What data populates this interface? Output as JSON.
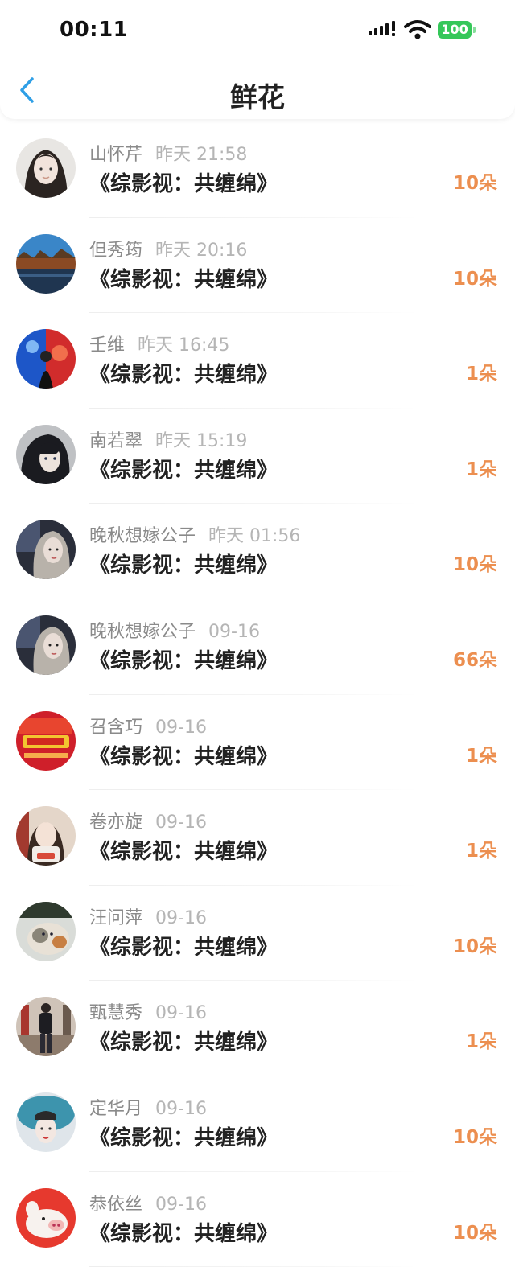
{
  "status_bar": {
    "time": "00:11",
    "battery": "100",
    "battery_color": "#35c759"
  },
  "nav": {
    "title": "鲜花",
    "back_icon": "chevron-left-icon",
    "accent": "#2f9fe6"
  },
  "colors": {
    "amount": "#ec8f50",
    "name": "#8a8a8a",
    "date": "#b5b5b5"
  },
  "records": [
    {
      "name": "山怀芹",
      "time": "昨天 21:58",
      "book": "《综影视：共缠绵》",
      "amount": "10朵",
      "avatar": "girl-portrait"
    },
    {
      "name": "但秀筠",
      "time": "昨天 20:16",
      "book": "《综影视：共缠绵》",
      "amount": "10朵",
      "avatar": "lake-landscape"
    },
    {
      "name": "壬维",
      "time": "昨天 16:45",
      "book": "《综影视：共缠绵》",
      "amount": "1朵",
      "avatar": "red-blue-art"
    },
    {
      "name": "南若翠",
      "time": "昨天 15:19",
      "book": "《综影视：共缠绵》",
      "amount": "1朵",
      "avatar": "anime-girl"
    },
    {
      "name": "晚秋想嫁公子",
      "time": "昨天 01:56",
      "book": "《综影视：共缠绵》",
      "amount": "10朵",
      "avatar": "woman-portrait"
    },
    {
      "name": "晚秋想嫁公子",
      "time": "09-16",
      "book": "《综影视：共缠绵》",
      "amount": "66朵",
      "avatar": "woman-portrait"
    },
    {
      "name": "召含巧",
      "time": "09-16",
      "book": "《综影视：共缠绵》",
      "amount": "1朵",
      "avatar": "red-poster"
    },
    {
      "name": "卷亦旋",
      "time": "09-16",
      "book": "《综影视：共缠绵》",
      "amount": "1朵",
      "avatar": "girl-photo"
    },
    {
      "name": "汪问萍",
      "time": "09-16",
      "book": "《综影视：共缠绵》",
      "amount": "10朵",
      "avatar": "cat-photo"
    },
    {
      "name": "甄慧秀",
      "time": "09-16",
      "book": "《综影视：共缠绵》",
      "amount": "1朵",
      "avatar": "man-standing"
    },
    {
      "name": "定华月",
      "time": "09-16",
      "book": "《综影视：共缠绵》",
      "amount": "10朵",
      "avatar": "woman-hat"
    },
    {
      "name": "恭依丝",
      "time": "09-16",
      "book": "《综影视：共缠绵》",
      "amount": "10朵",
      "avatar": "pig-toy"
    }
  ]
}
